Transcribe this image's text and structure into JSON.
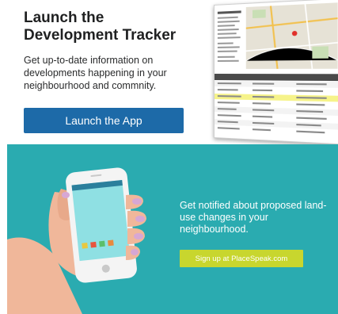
{
  "tracker": {
    "title_line1": "Launch the",
    "title_line2": "Development Tracker",
    "description": "Get up-to-date information on developments happening in your neighbourhood and commnity.",
    "button_label": "Launch the App"
  },
  "banner": {
    "notify_text": "Get notified about proposed land-use changes in your neighbourhood.",
    "signup_label": "Sign up at PlaceSpeak.com"
  },
  "colors": {
    "primary_button": "#1d6aa8",
    "banner_background": "#2aabb0",
    "signup_button": "#c8d62e"
  },
  "icons": {
    "app_preview": "map-screenshot",
    "phone": "smartphone-in-hand-illustration"
  }
}
